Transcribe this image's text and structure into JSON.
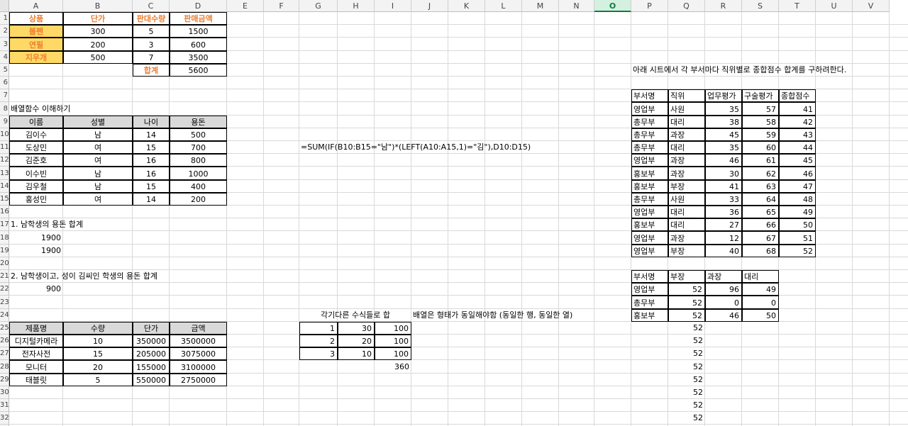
{
  "columns": [
    "A",
    "B",
    "C",
    "D",
    "E",
    "F",
    "G",
    "H",
    "I",
    "J",
    "K",
    "L",
    "M",
    "N",
    "O",
    "P",
    "Q",
    "R",
    "S",
    "T",
    "U",
    "V"
  ],
  "selected_column": "O",
  "rows": [
    "1",
    "2",
    "3",
    "4",
    "5",
    "6",
    "7",
    "8",
    "9",
    "10",
    "11",
    "12",
    "13",
    "14",
    "15",
    "16",
    "17",
    "18",
    "19",
    "20",
    "21",
    "22",
    "23",
    "24",
    "25",
    "26",
    "27",
    "28",
    "29",
    "30",
    "31",
    "32",
    "33"
  ],
  "sales": {
    "headers": [
      "상품",
      "단가",
      "판대수량",
      "판매금액"
    ],
    "rows": [
      [
        "볼펜",
        "300",
        "5",
        "1500"
      ],
      [
        "연필",
        "200",
        "3",
        "600"
      ],
      [
        "지우개",
        "500",
        "7",
        "3500"
      ]
    ],
    "total_label": "합계",
    "total_value": "5600"
  },
  "array_title": "배열함수 이해하기",
  "students": {
    "headers": [
      "이름",
      "성별",
      "나이",
      "용돈"
    ],
    "rows": [
      [
        "김이수",
        "남",
        "14",
        "500"
      ],
      [
        "도상민",
        "여",
        "15",
        "700"
      ],
      [
        "김준호",
        "여",
        "16",
        "800"
      ],
      [
        "이수빈",
        "남",
        "16",
        "1000"
      ],
      [
        "김우철",
        "남",
        "15",
        "400"
      ],
      [
        "홍성민",
        "여",
        "14",
        "200"
      ]
    ]
  },
  "formula_text": "=SUM(IF(B10:B15=\"남\")*(LEFT(A10:A15,1)=\"김\"),D10:D15)",
  "q1": {
    "label": "1. 남학생의 용돈 합계",
    "values": [
      "1900",
      "1900"
    ]
  },
  "q2": {
    "label": "2. 남학생이고, 성이 김씨인 학생의 용돈 합계",
    "value": "900"
  },
  "products": {
    "headers": [
      "제품명",
      "수량",
      "단가",
      "금액"
    ],
    "rows": [
      [
        "디지털카메라",
        "10",
        "350000",
        "3500000"
      ],
      [
        "전자사전",
        "15",
        "205000",
        "3075000"
      ],
      [
        "모니터",
        "20",
        "155000",
        "3100000"
      ],
      [
        "태블릿",
        "5",
        "550000",
        "2750000"
      ]
    ]
  },
  "mini": {
    "title": "각기다른 수식들로 합",
    "note": "배열은 형태가 동일해야함 (동일한 행, 동일한 열)",
    "rows": [
      [
        "1",
        "30",
        "100"
      ],
      [
        "2",
        "20",
        "100"
      ],
      [
        "3",
        "10",
        "100"
      ]
    ],
    "total": "360"
  },
  "instruction": "아래 시트에서 각 부서마다 직위별로 종합점수 합계를 구하려한다.",
  "dept": {
    "headers": [
      "부서명",
      "직위",
      "업무평가",
      "구술평가",
      "종합점수"
    ],
    "rows": [
      [
        "영업부",
        "사원",
        "35",
        "57",
        "41"
      ],
      [
        "총무부",
        "대리",
        "38",
        "58",
        "42"
      ],
      [
        "총무부",
        "과장",
        "45",
        "59",
        "43"
      ],
      [
        "총무부",
        "대리",
        "35",
        "60",
        "44"
      ],
      [
        "영업부",
        "과장",
        "46",
        "61",
        "45"
      ],
      [
        "홍보부",
        "과장",
        "30",
        "62",
        "46"
      ],
      [
        "홍보부",
        "부장",
        "41",
        "63",
        "47"
      ],
      [
        "총무부",
        "사원",
        "33",
        "64",
        "48"
      ],
      [
        "영업부",
        "대리",
        "36",
        "65",
        "49"
      ],
      [
        "홍보부",
        "대리",
        "27",
        "66",
        "50"
      ],
      [
        "영업부",
        "과장",
        "12",
        "67",
        "51"
      ],
      [
        "영업부",
        "부장",
        "40",
        "68",
        "52"
      ]
    ]
  },
  "summary": {
    "headers": [
      "부서명",
      "부장",
      "과장",
      "대리"
    ],
    "rows": [
      [
        "영업부",
        "52",
        "96",
        "49"
      ],
      [
        "총무부",
        "52",
        "0",
        "0"
      ],
      [
        "홍보부",
        "52",
        "46",
        "50"
      ]
    ]
  },
  "spill": [
    "52",
    "52",
    "52",
    "52",
    "52",
    "52",
    "52",
    "52",
    "52",
    "52"
  ]
}
